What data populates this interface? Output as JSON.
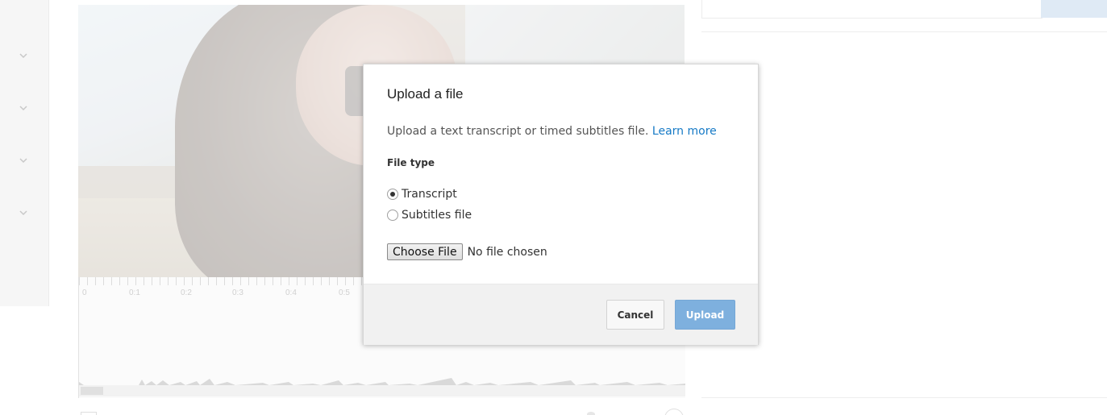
{
  "dialog": {
    "title": "Upload a file",
    "description": "Upload a text transcript or timed subtitles file.",
    "learn_more_label": "Learn more",
    "file_type_label": "File type",
    "options": [
      {
        "label": "Transcript",
        "checked": true
      },
      {
        "label": "Subtitles file",
        "checked": false
      }
    ],
    "choose_file_label": "Choose File",
    "no_file_text": "No file chosen",
    "cancel_label": "Cancel",
    "upload_label": "Upload"
  },
  "timeline": {
    "tick_labels": [
      "0",
      "0:1",
      "0:2",
      "0:3",
      "0:4",
      "0:5"
    ]
  },
  "colors": {
    "link": "#167ac6",
    "primary_button": "#7eb0de",
    "footer_bg": "#f1f1f1"
  },
  "icons": {
    "sidebar_expanders": [
      "chevron-down-icon",
      "chevron-down-icon",
      "chevron-down-icon",
      "chevron-down-icon"
    ]
  }
}
